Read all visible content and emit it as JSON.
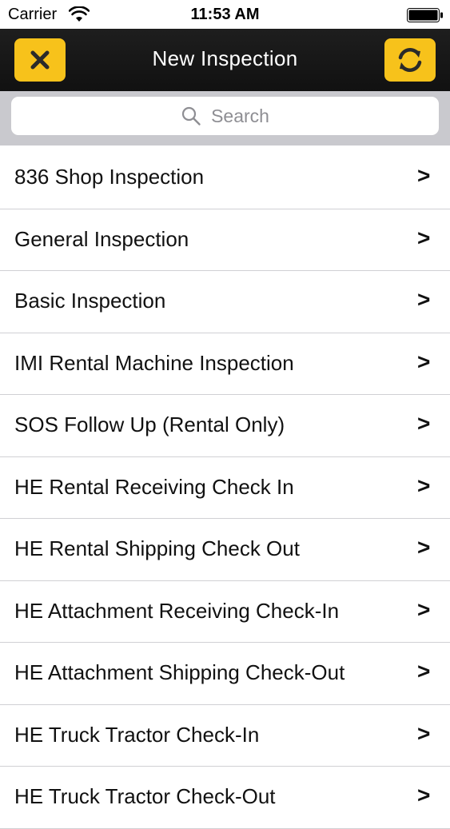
{
  "status_bar": {
    "carrier": "Carrier",
    "time": "11:53 AM"
  },
  "nav": {
    "title": "New Inspection",
    "left_icon": "close-icon",
    "right_icon": "refresh-icon",
    "accent_color": "#f7c21b"
  },
  "search": {
    "placeholder": "Search"
  },
  "list": {
    "chevron": ">",
    "items": [
      {
        "label": "836 Shop Inspection"
      },
      {
        "label": "General Inspection"
      },
      {
        "label": "Basic Inspection"
      },
      {
        "label": "IMI Rental Machine Inspection"
      },
      {
        "label": "SOS Follow Up (Rental Only)"
      },
      {
        "label": "HE Rental Receiving Check In"
      },
      {
        "label": "HE Rental Shipping Check Out"
      },
      {
        "label": "HE Attachment Receiving Check-In"
      },
      {
        "label": "HE Attachment Shipping Check-Out"
      },
      {
        "label": "HE Truck Tractor Check-In"
      },
      {
        "label": "HE Truck Tractor Check-Out"
      }
    ]
  }
}
